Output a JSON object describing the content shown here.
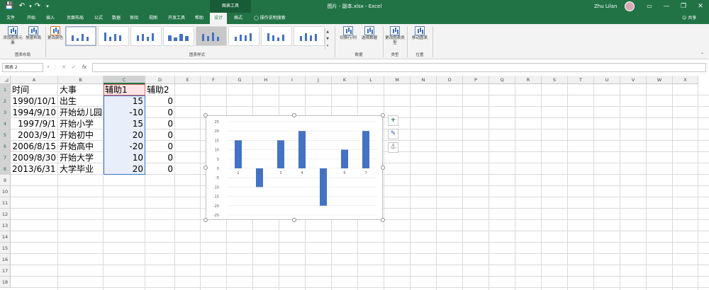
{
  "titlebar": {
    "context_header": "图表工具",
    "doc_title": "图片 - 副本.xlsx  -  Excel",
    "user_name": "Zhu Lilan",
    "save_icon": "save-icon",
    "undo_icon": "undo-icon",
    "redo_icon": "redo-icon",
    "min_symbol": "—",
    "restore_symbol": "❐",
    "close_symbol": "✕",
    "ribbon_display_symbol": "▭"
  },
  "tabs": [
    "文件",
    "开始",
    "插入",
    "页面布局",
    "公式",
    "数据",
    "审阅",
    "视图",
    "开发工具",
    "帮助",
    "设计",
    "格式"
  ],
  "active_tab": "设计",
  "tell_me": "操作说明搜索",
  "share": "共享",
  "ribbon": {
    "add_element": "添加图表元素",
    "quick_layout": "快速布局",
    "change_colors": "更改颜色",
    "group_layout": "图表布局",
    "group_styles": "图表样式",
    "switch_row_col": "切换行/列",
    "select_data": "选择数据",
    "group_data": "数据",
    "change_type": "更改图表类型",
    "group_type": "类型",
    "move_chart": "移动图表",
    "group_location": "位置"
  },
  "formula_bar": {
    "name_box": "图表 2",
    "fx": "fx",
    "cancel": "✕",
    "enter": "✓",
    "formula": ""
  },
  "columns": [
    "A",
    "B",
    "C",
    "D",
    "E",
    "F",
    "G",
    "H",
    "I",
    "J",
    "K",
    "L",
    "M",
    "N",
    "O",
    "P",
    "Q",
    "R",
    "S",
    "T",
    "U",
    "V",
    "W",
    "X"
  ],
  "rows": [
    "1",
    "2",
    "3",
    "4",
    "5",
    "6",
    "7",
    "8",
    "9",
    "10",
    "11",
    "12",
    "13",
    "14",
    "15",
    "16",
    "17",
    "18"
  ],
  "cells": {
    "headers": [
      "时间",
      "大事",
      "辅助1",
      "辅助2"
    ],
    "time": [
      "1990/10/1",
      "1994/9/10",
      "1997/9/1",
      "2003/9/1",
      "2006/8/15",
      "2009/8/30",
      "2013/6/31"
    ],
    "event": [
      "出生",
      "开始幼儿园",
      "开始小学",
      "开始初中",
      "开始高中",
      "开始大学",
      "大学毕业"
    ],
    "aux1": [
      "15",
      "-10",
      "15",
      "20",
      "-20",
      "10",
      "20"
    ],
    "aux2": [
      "0",
      "0",
      "0",
      "0",
      "0",
      "0",
      "0"
    ]
  },
  "chart_side_buttons": {
    "add": "+",
    "style": "✎",
    "filter": "⏃"
  },
  "chart_data": {
    "type": "bar",
    "categories": [
      "1",
      "2",
      "3",
      "4",
      "5",
      "6",
      "7"
    ],
    "series": [
      {
        "values": [
          15,
          -10,
          15,
          20,
          -20,
          10,
          20
        ]
      }
    ],
    "ylim": [
      -25,
      25
    ],
    "yticks": [
      "25",
      "20",
      "15",
      "10",
      "5",
      "0",
      "-5",
      "-10",
      "-15",
      "-20",
      "-25"
    ],
    "grid": true,
    "color": "#4472c4"
  },
  "colors": {
    "excel_green": "#217346",
    "ribbon_bg": "#f3f3f3",
    "bar": "#4472c4"
  }
}
